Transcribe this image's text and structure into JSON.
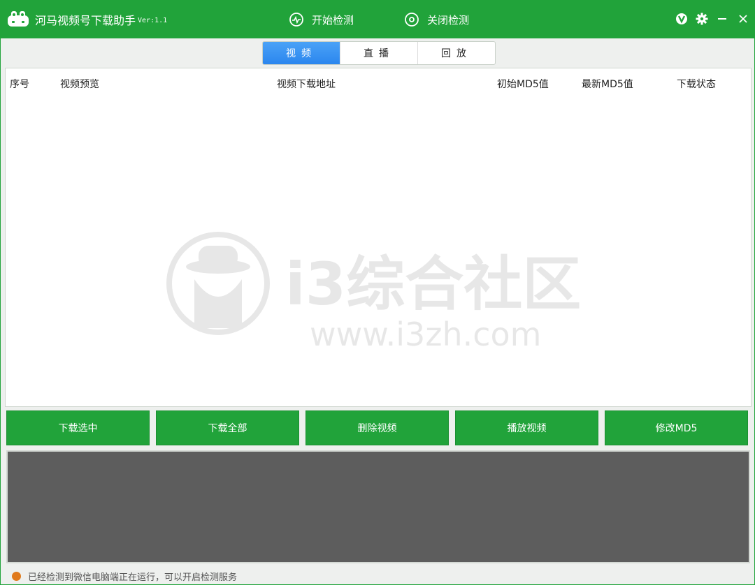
{
  "app": {
    "title": "河马视频号下载助手",
    "version": "Ver:1.1"
  },
  "titlebar": {
    "start_label": "开始检测",
    "stop_label": "关闭检测",
    "icons": [
      "v-logo-icon",
      "gear-icon",
      "minimize-icon",
      "close-icon"
    ]
  },
  "tabs": [
    {
      "label": "视频",
      "active": true
    },
    {
      "label": "直播",
      "active": false
    },
    {
      "label": "回放",
      "active": false
    }
  ],
  "table": {
    "columns": [
      "序号",
      "视频预览",
      "视频下载地址",
      "初始MD5值",
      "最新MD5值",
      "下载状态"
    ],
    "rows": []
  },
  "watermark": {
    "text": "i3综合社区",
    "url": "www.i3zh.com"
  },
  "buttons": {
    "download_selected": "下载选中",
    "download_all": "下载全部",
    "delete_video": "删除视频",
    "play_video": "播放视频",
    "modify_md5": "修改MD5"
  },
  "status": {
    "text": "已经检测到微信电脑端正在运行，可以开启检测服务",
    "dot_color": "#e07a1c"
  },
  "colors": {
    "accent": "#21a33a",
    "tab_active": "#2b86ee",
    "log_bg": "#5d5d5d"
  }
}
